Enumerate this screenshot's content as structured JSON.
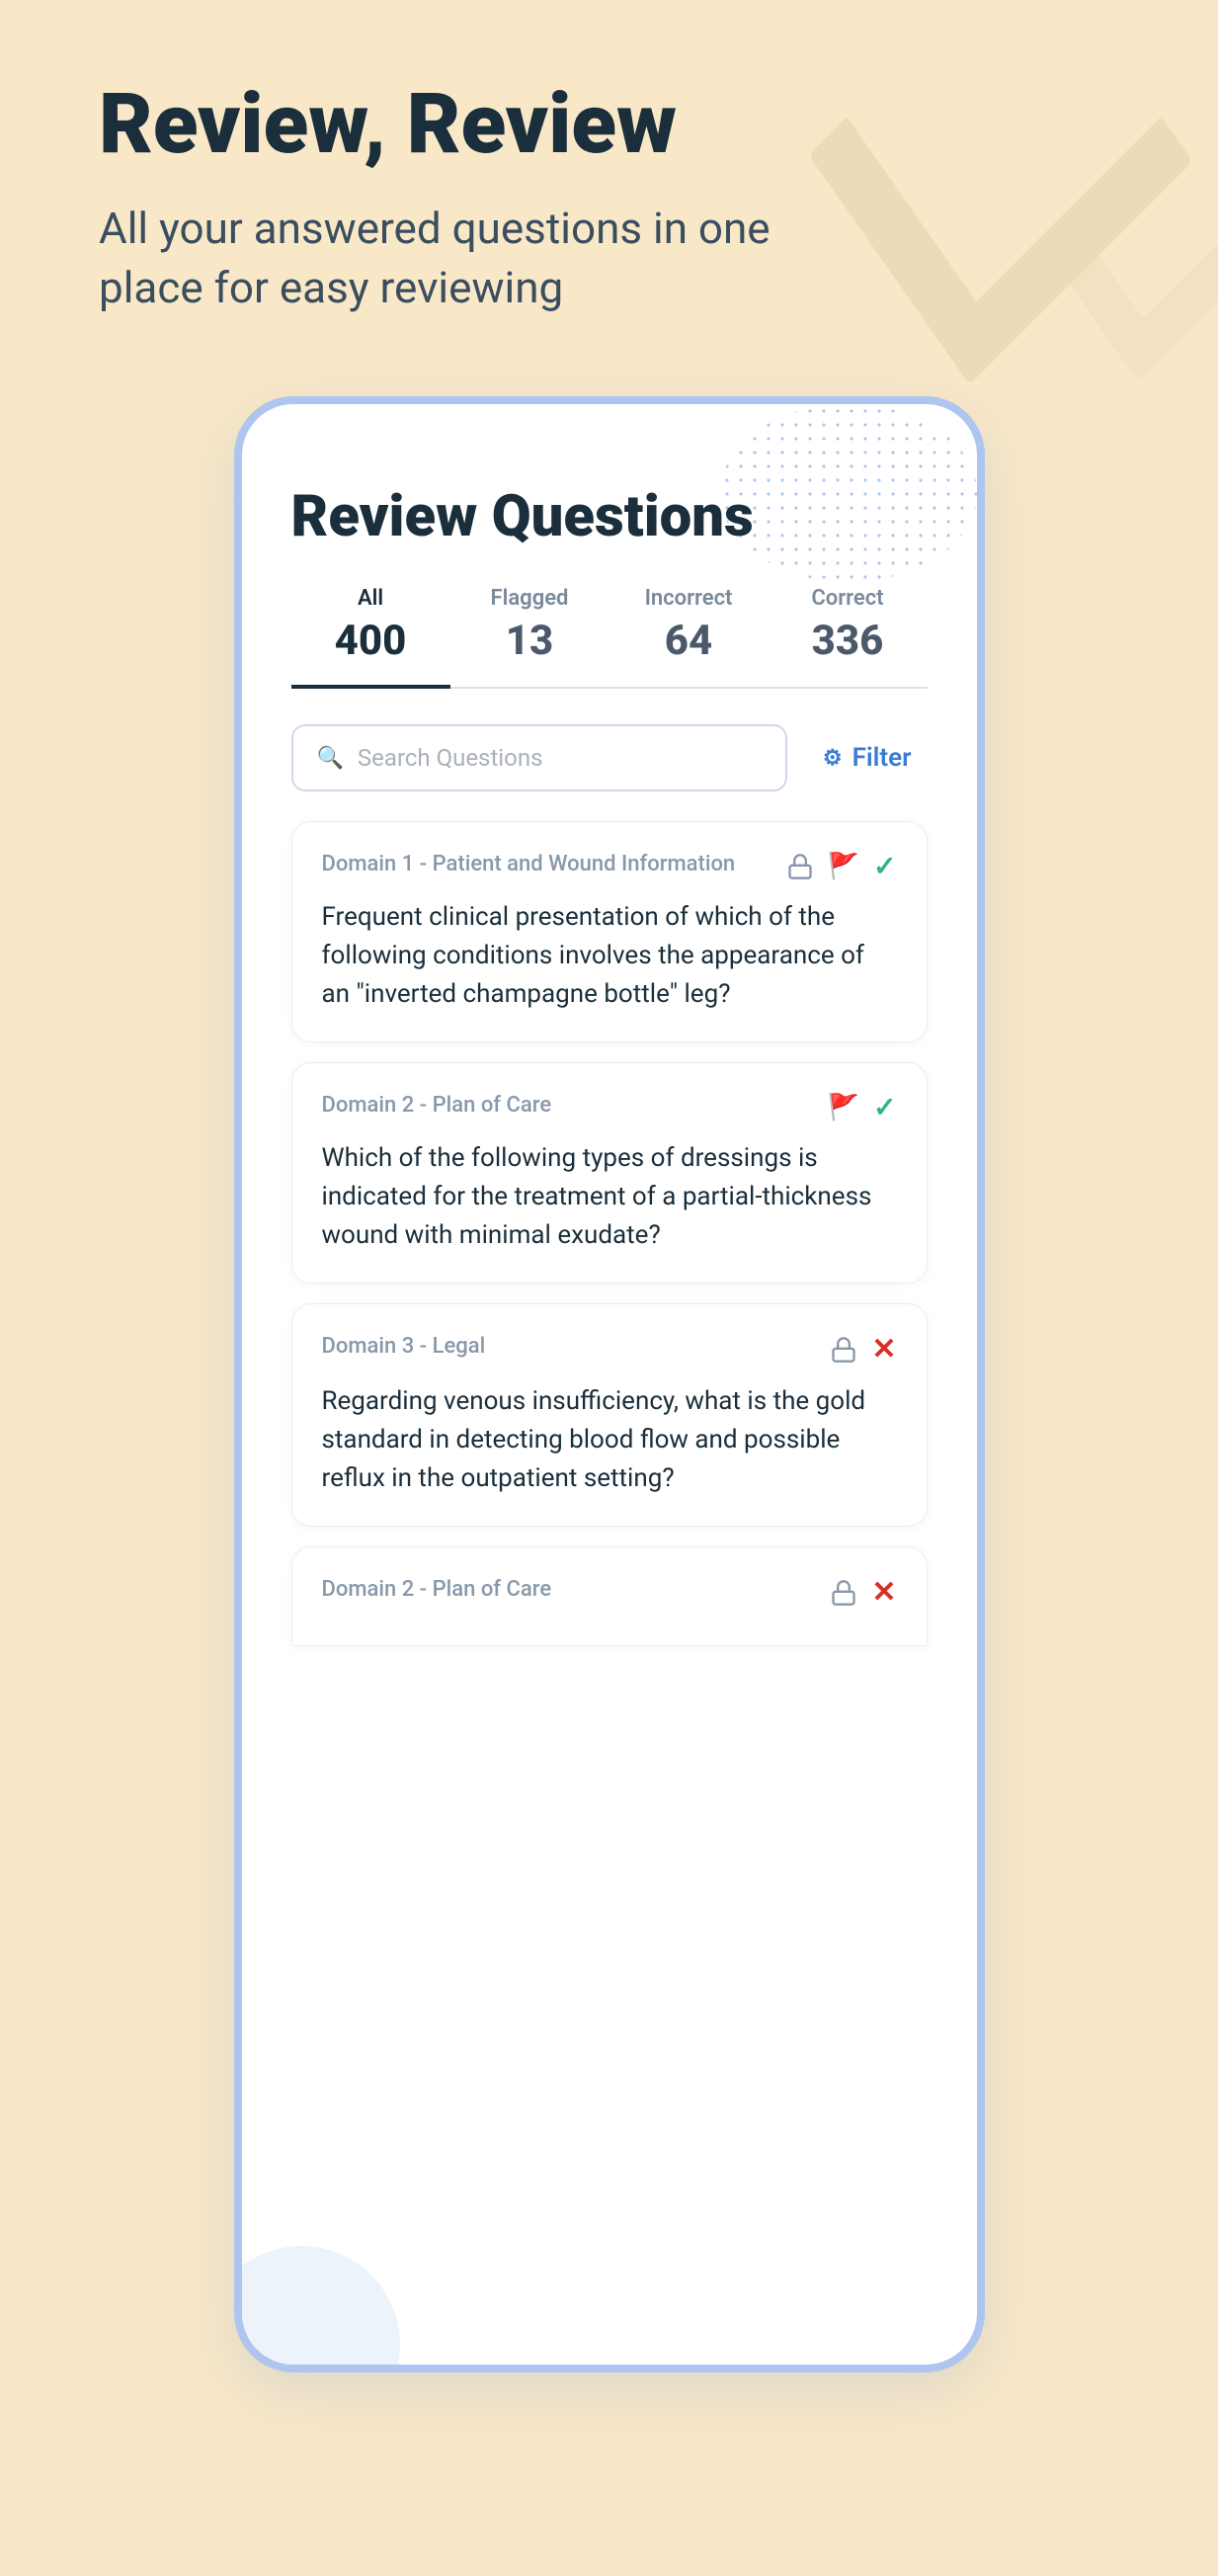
{
  "hero": {
    "title": "Review, Review",
    "subtitle": "All your answered questions in one place for easy reviewing"
  },
  "phone": {
    "title": "Review Questions",
    "tabs": [
      {
        "id": "all",
        "label": "All",
        "count": "400",
        "active": true
      },
      {
        "id": "flagged",
        "label": "Flagged",
        "count": "13",
        "active": false
      },
      {
        "id": "incorrect",
        "label": "Incorrect",
        "count": "64",
        "active": false
      },
      {
        "id": "correct",
        "label": "Correct",
        "count": "336",
        "active": false
      }
    ],
    "search": {
      "placeholder": "Search Questions"
    },
    "filter_label": "Filter",
    "questions": [
      {
        "domain": "Domain 1 - Patient and Wound Information",
        "has_lock": true,
        "has_flag": true,
        "has_check": true,
        "has_x": false,
        "text": "Frequent clinical presentation of which of the following conditions involves the appearance of an \"inverted champagne bottle\" leg?"
      },
      {
        "domain": "Domain 2 - Plan of Care",
        "has_lock": false,
        "has_flag": true,
        "has_check": true,
        "has_x": false,
        "text": "Which of the following types of dressings is indicated for the treatment of a partial-thickness wound with minimal exudate?"
      },
      {
        "domain": "Domain 3 - Legal",
        "has_lock": true,
        "has_flag": false,
        "has_check": false,
        "has_x": true,
        "text": "Regarding venous insufficiency, what is the gold standard in detecting blood flow and possible reflux in the outpatient setting?"
      },
      {
        "domain": "Domain 2 - Plan of Care",
        "has_lock": true,
        "has_flag": false,
        "has_check": false,
        "has_x": true,
        "text": "",
        "partial": true
      }
    ]
  }
}
